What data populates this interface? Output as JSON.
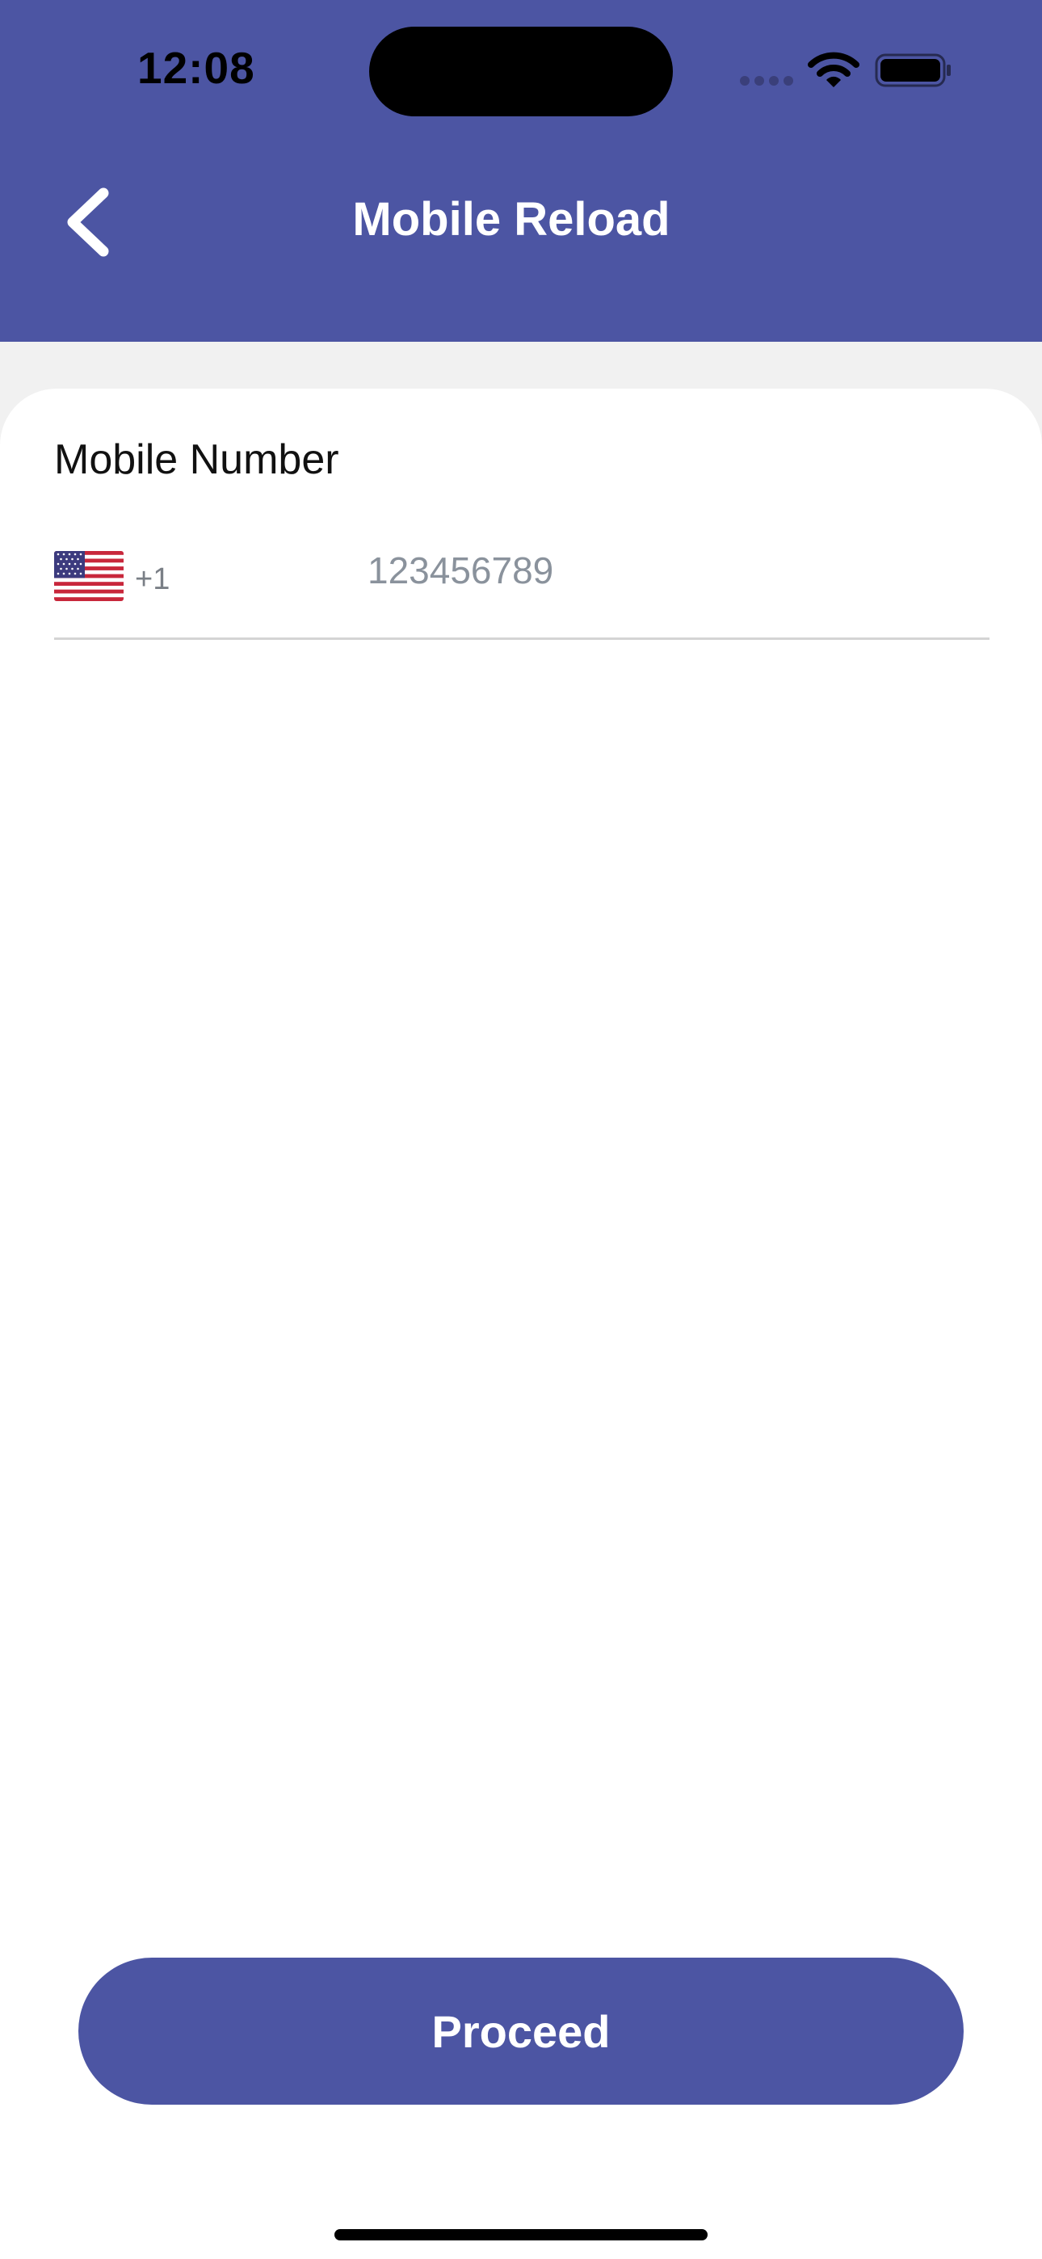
{
  "status_bar": {
    "time": "12:08"
  },
  "header": {
    "title": "Mobile Reload",
    "back_icon": "chevron-left-icon"
  },
  "form": {
    "label": "Mobile Number",
    "country": {
      "flag": "us-flag-icon",
      "dial_code": "+1"
    },
    "phone": {
      "value": "",
      "placeholder": "123456789"
    }
  },
  "actions": {
    "proceed_label": "Proceed"
  },
  "colors": {
    "primary": "#4c55a3",
    "background": "#f1f1f1",
    "card": "#ffffff"
  }
}
